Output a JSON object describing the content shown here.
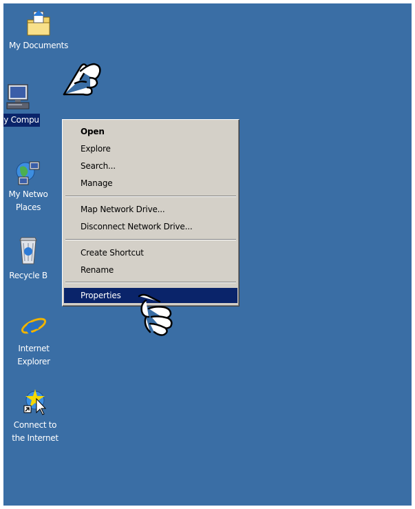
{
  "desktop": {
    "background": "#3a6ea5",
    "icons": [
      {
        "label": "My Documents",
        "icon": "my-documents-icon"
      },
      {
        "label": "My Compu",
        "icon": "my-computer-icon",
        "selected": true
      },
      {
        "label_line1": "My Netwo",
        "label_line2": "Places",
        "icon": "my-network-places-icon"
      },
      {
        "label": "Recycle B",
        "icon": "recycle-bin-icon"
      },
      {
        "label_line1": "Internet",
        "label_line2": "Explorer",
        "icon": "internet-explorer-icon"
      },
      {
        "label_line1": "Connect to",
        "label_line2": "the Internet",
        "icon": "connect-to-internet-icon"
      }
    ]
  },
  "context_menu": {
    "items": [
      {
        "label": "Open",
        "bold": true
      },
      {
        "label": "Explore"
      },
      {
        "label": "Search..."
      },
      {
        "label": "Manage"
      },
      {
        "label": "Map Network Drive..."
      },
      {
        "label": "Disconnect Network Drive..."
      },
      {
        "label": "Create Shortcut"
      },
      {
        "label": "Rename"
      },
      {
        "label": "Properties",
        "highlighted": true
      }
    ]
  },
  "pointers": [
    "pointing-hand-icon",
    "pointing-hand-icon"
  ]
}
